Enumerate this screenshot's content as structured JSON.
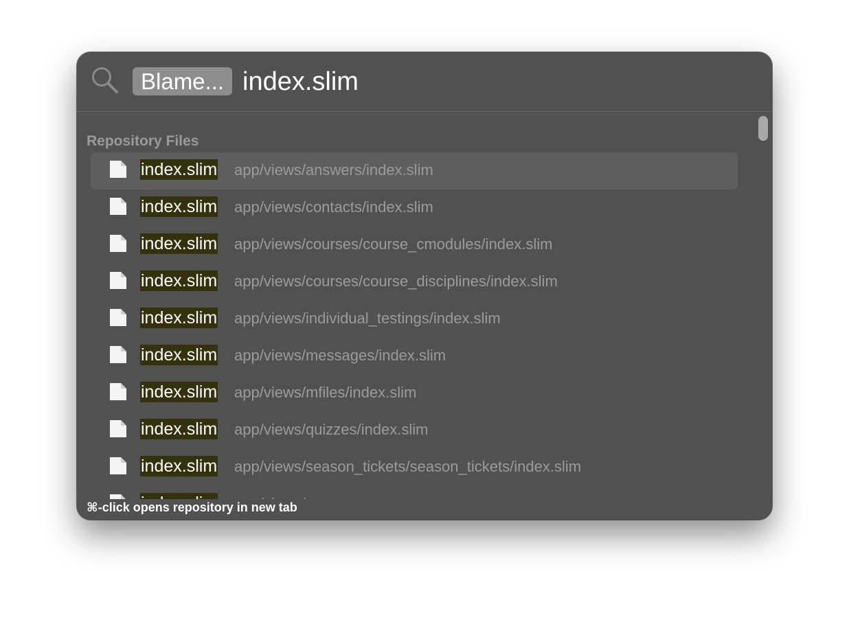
{
  "search": {
    "scope_chip": "Blame...",
    "query": "index.slim",
    "icon": "search-icon"
  },
  "section": {
    "header": "Repository Files"
  },
  "results": [
    {
      "name": "index.slim",
      "path": "app/views/answers/index.slim",
      "selected": true
    },
    {
      "name": "index.slim",
      "path": "app/views/contacts/index.slim",
      "selected": false
    },
    {
      "name": "index.slim",
      "path": "app/views/courses/course_cmodules/index.slim",
      "selected": false
    },
    {
      "name": "index.slim",
      "path": "app/views/courses/course_disciplines/index.slim",
      "selected": false
    },
    {
      "name": "index.slim",
      "path": "app/views/individual_testings/index.slim",
      "selected": false
    },
    {
      "name": "index.slim",
      "path": "app/views/messages/index.slim",
      "selected": false
    },
    {
      "name": "index.slim",
      "path": "app/views/mfiles/index.slim",
      "selected": false
    },
    {
      "name": "index.slim",
      "path": "app/views/quizzes/index.slim",
      "selected": false
    },
    {
      "name": "index.slim",
      "path": "app/views/season_tickets/season_tickets/index.slim",
      "selected": false
    },
    {
      "name": "index.slim",
      "path": "app/views/...",
      "selected": false
    }
  ],
  "footer": {
    "hint": "⌘-click opens repository in new tab"
  },
  "colors": {
    "panel_bg": "#515151",
    "selected_row": "#5e5e5e",
    "match_highlight": "#34320d",
    "path_text": "#9b9b9b"
  }
}
